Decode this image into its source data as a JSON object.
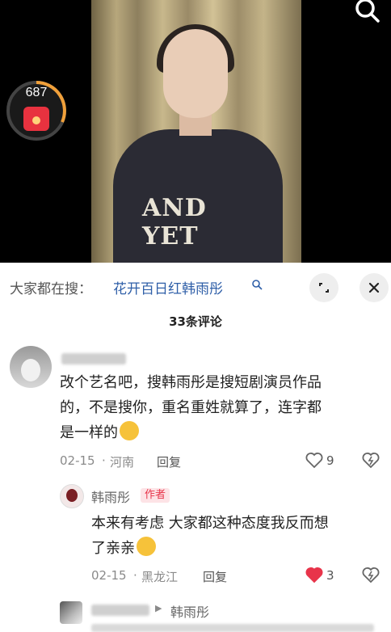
{
  "video": {
    "timer_count": "687",
    "shirt_text": "AND YET"
  },
  "search": {
    "prefix": "大家都在搜：",
    "term": "花开百日红韩雨彤"
  },
  "comments_header": "33条评论",
  "comments": [
    {
      "text": "改个艺名吧，搜韩雨彤是搜短剧演员作品的，不是搜你，重名重姓就算了，连字都是一样的",
      "line1": "改个艺名吧，搜韩雨彤是搜短剧演员作品",
      "line2": "的，不是搜你，重名重姓就算了，连字都",
      "line3": "是一样的",
      "date": "02-15",
      "location": "河南",
      "reply_label": "回复",
      "like_count": "9"
    }
  ],
  "reply": {
    "name": "韩雨彤",
    "badge": "作者",
    "line1": "本来有考虑 大家都这种态度我反而想",
    "line2": "了亲亲",
    "date": "02-15",
    "location": "黑龙江",
    "reply_label": "回复",
    "like_count": "3"
  },
  "next_reply": {
    "reply_to_name": "韩雨彤"
  },
  "colors": {
    "link_blue": "#2f5fa8",
    "like_red": "#e8344a",
    "meta_gray": "#8a8a8a"
  }
}
